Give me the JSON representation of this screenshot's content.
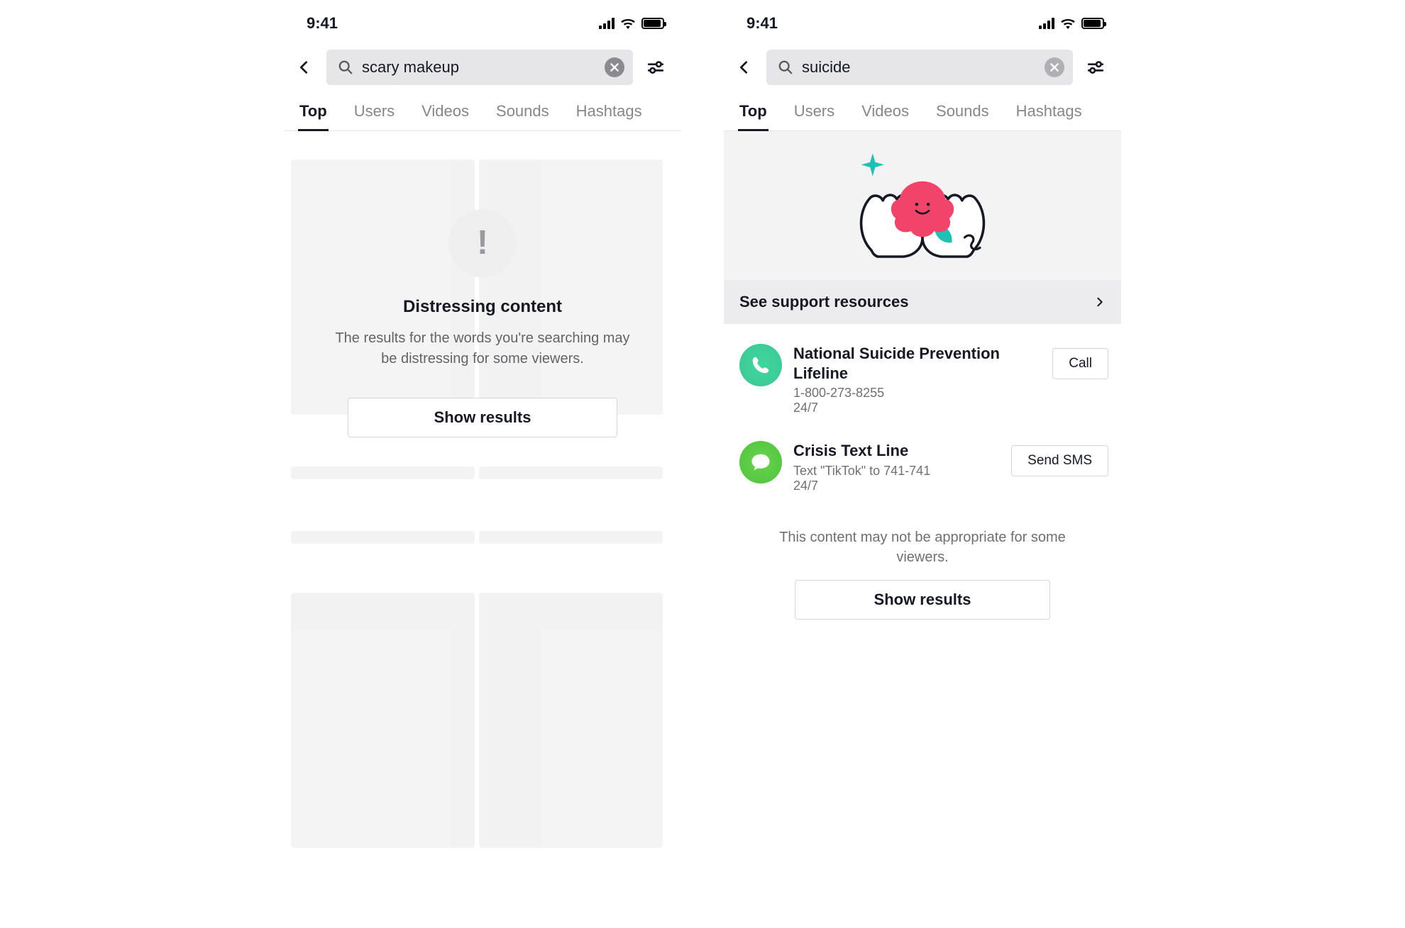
{
  "status": {
    "time": "9:41"
  },
  "tabs": [
    "Top",
    "Users",
    "Videos",
    "Sounds",
    "Hashtags"
  ],
  "screenA": {
    "search_query": "scary makeup",
    "warning_title": "Distressing content",
    "warning_subtitle": "The results for the words you're searching may be distressing for some viewers.",
    "show_results_label": "Show results"
  },
  "screenB": {
    "search_query": "suicide",
    "banner_cta": "See support resources",
    "resources": [
      {
        "title": "National Suicide Prevention Lifeline",
        "line1": "1-800-273-8255",
        "line2": "24/7",
        "action_label": "Call",
        "icon": "phone"
      },
      {
        "title": "Crisis Text Line",
        "line1": "Text \"TikTok\" to 741-741",
        "line2": "24/7",
        "action_label": "Send SMS",
        "icon": "chat"
      }
    ],
    "footer_note": "This content may not be appropriate for some viewers.",
    "show_results_label": "Show results"
  }
}
